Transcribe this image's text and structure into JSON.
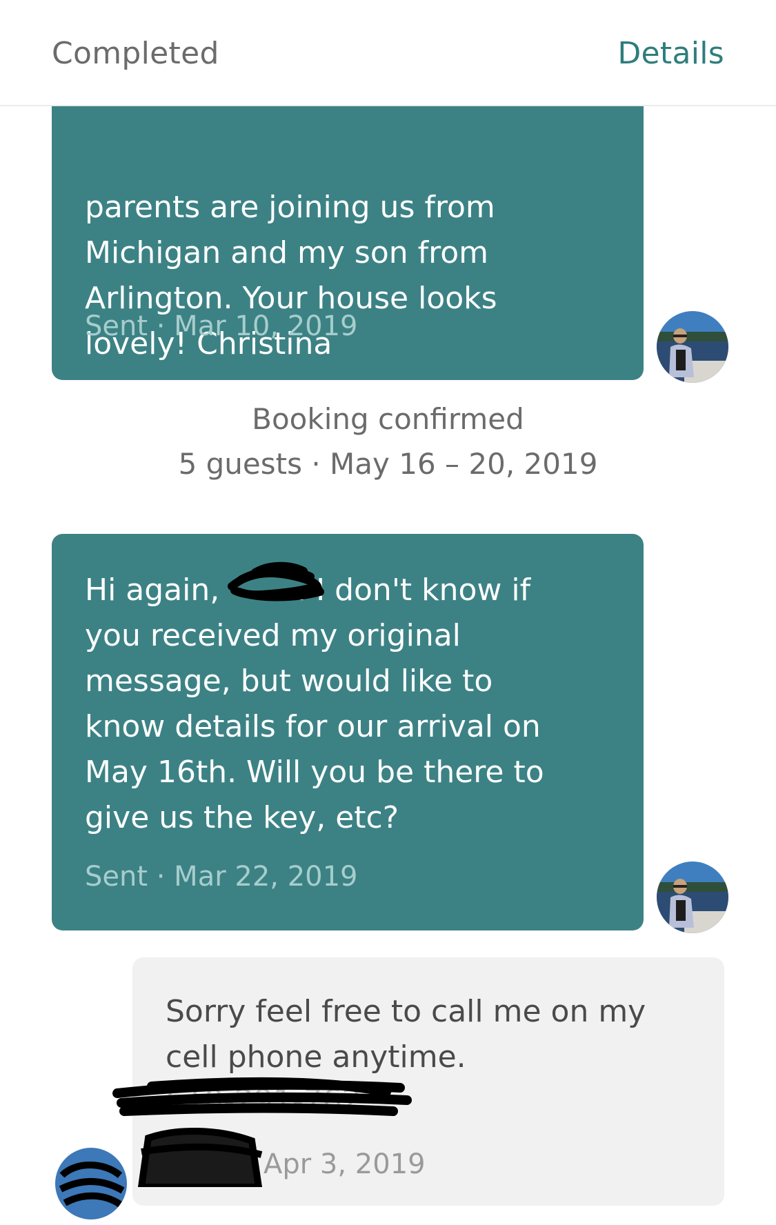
{
  "header": {
    "status_label": "Completed",
    "details_label": "Details"
  },
  "colors": {
    "accent": "#2f7d7d",
    "outgoing_bubble": "#3c8285",
    "incoming_bubble": "#f1f1f1"
  },
  "messages": [
    {
      "direction": "outgoing",
      "text": "parents are joining us from\nMichigan and my son from\nArlington. Your house looks\nlovely! Christina",
      "meta": "Sent · Mar 10, 2019"
    },
    {
      "direction": "outgoing",
      "text": "Hi again,        . I don't know if\nyou received my original\nmessage, but would like to\nknow details for our arrival on\nMay 16th. Will you be there to\ngive us the key, etc?",
      "meta": "Sent · Mar 22, 2019"
    },
    {
      "direction": "incoming",
      "text": "Sorry feel free to call me on my\ncell phone anytime.",
      "phone": "610-291-762",
      "meta": "Apr 3, 2019"
    }
  ],
  "booking_event": {
    "title": "Booking confirmed",
    "summary": "5 guests · May 16 – 20, 2019"
  },
  "icons": {
    "user_avatar": "avatar-photo-icon",
    "host_avatar": "avatar-photo-icon"
  }
}
